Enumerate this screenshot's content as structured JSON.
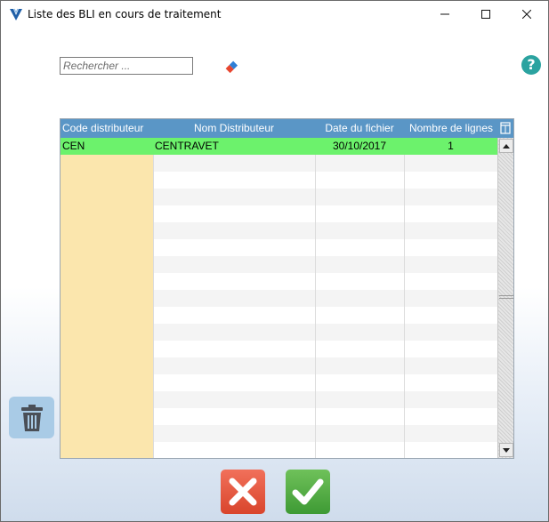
{
  "window": {
    "title": "Liste des BLI en cours de traitement",
    "controls": {
      "minimize": "─",
      "maximize": "☐",
      "close": "✕"
    }
  },
  "search": {
    "placeholder": "Rechercher ...",
    "value": ""
  },
  "icons": {
    "app": "app-logo-icon",
    "eraser": "eraser-icon",
    "help": "help-icon",
    "help_glyph": "?",
    "column_config": "column-config-icon",
    "trash": "trash-icon",
    "cancel": "cancel-x-icon",
    "ok": "checkmark-icon"
  },
  "colors": {
    "header": "#5a96c6",
    "selected_row": "#6cf26c",
    "code_column": "#fbe6ad",
    "cancel": "#e5553c",
    "ok": "#52ad46",
    "help": "#2ba3a0"
  },
  "table": {
    "columns": [
      "Code distributeur",
      "Nom Distributeur",
      "Date du fichier",
      "Nombre de lignes"
    ],
    "rows": [
      {
        "code": "CEN",
        "nom": "CENTRAVET",
        "date": "30/10/2017",
        "nb": "1"
      }
    ],
    "selected_index": 0
  }
}
